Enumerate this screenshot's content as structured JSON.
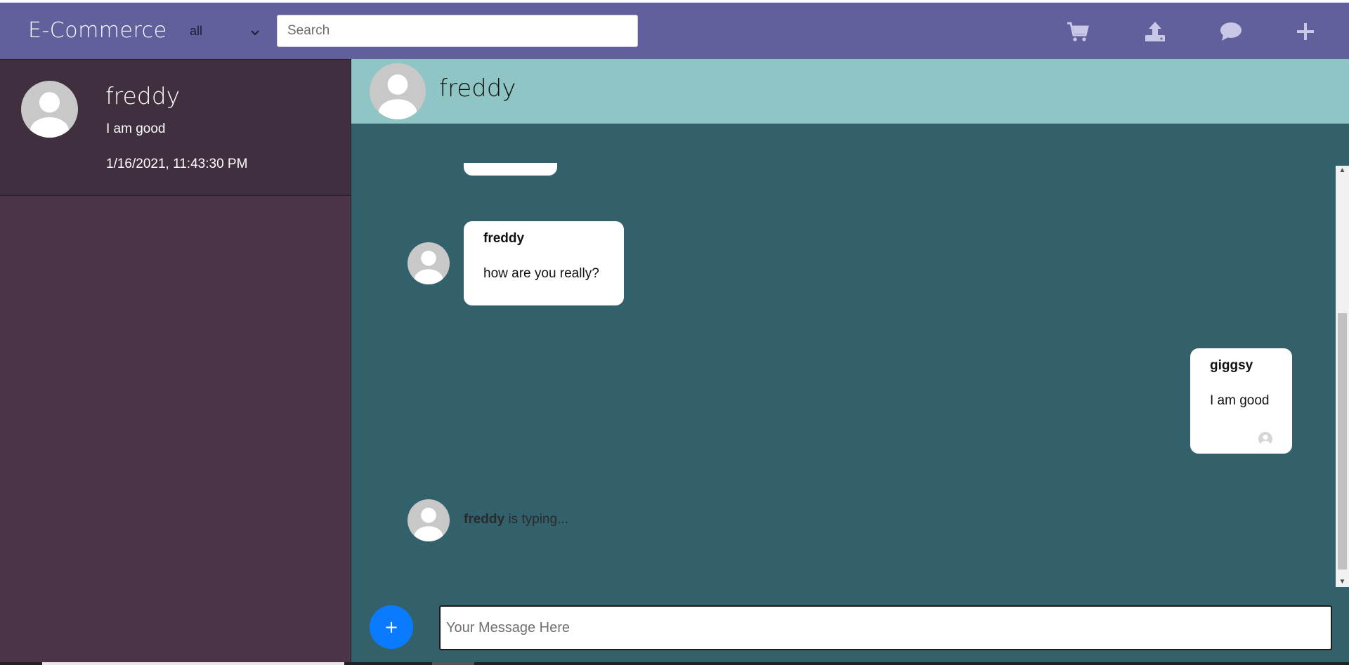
{
  "navbar": {
    "brand": "E-Commerce",
    "category": "all",
    "search_placeholder": "Search",
    "icons": [
      "cart-icon",
      "upload-icon",
      "chat-icon",
      "plus-icon"
    ]
  },
  "sidebar": {
    "contacts": [
      {
        "name": "freddy",
        "last_message": "I am good",
        "timestamp": "1/16/2021, 11:43:30 PM"
      }
    ]
  },
  "chat": {
    "header_name": "freddy",
    "messages": [
      {
        "sender": "freddy",
        "text": "how are you really?",
        "side": "left"
      },
      {
        "sender": "giggsy",
        "text": "I am good",
        "side": "right"
      }
    ],
    "typing": {
      "name": "freddy",
      "text": "is typing..."
    },
    "input_placeholder": "Your Message Here",
    "add_button_label": "+"
  },
  "colors": {
    "navbar": "#615f9c",
    "sidebar": "#4b3448",
    "sidebar_active": "#402f3e",
    "chat_header": "#8fc5c5",
    "chat_background": "#33616b",
    "add_button": "#0a7bff"
  }
}
